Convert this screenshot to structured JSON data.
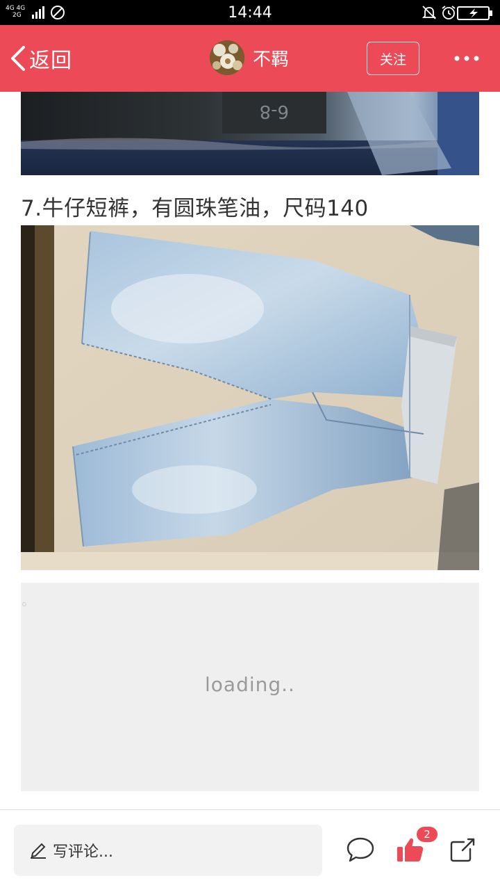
{
  "status_bar": {
    "network_top": "4G 4G",
    "network_bottom": "2G",
    "time": "14:44"
  },
  "header": {
    "back_label": "返回",
    "author_name": "不羁",
    "follow_label": "关注",
    "accent_color": "#ed4a57"
  },
  "content": {
    "caption": "7.牛仔短裤，有圆珠笔油，尺码140",
    "loading_text": "loading.."
  },
  "bottom_bar": {
    "comment_placeholder": "写评论...",
    "like_count": "2",
    "icons": [
      "pencil-icon",
      "comment-icon",
      "thumbs-up-icon",
      "share-icon"
    ]
  }
}
